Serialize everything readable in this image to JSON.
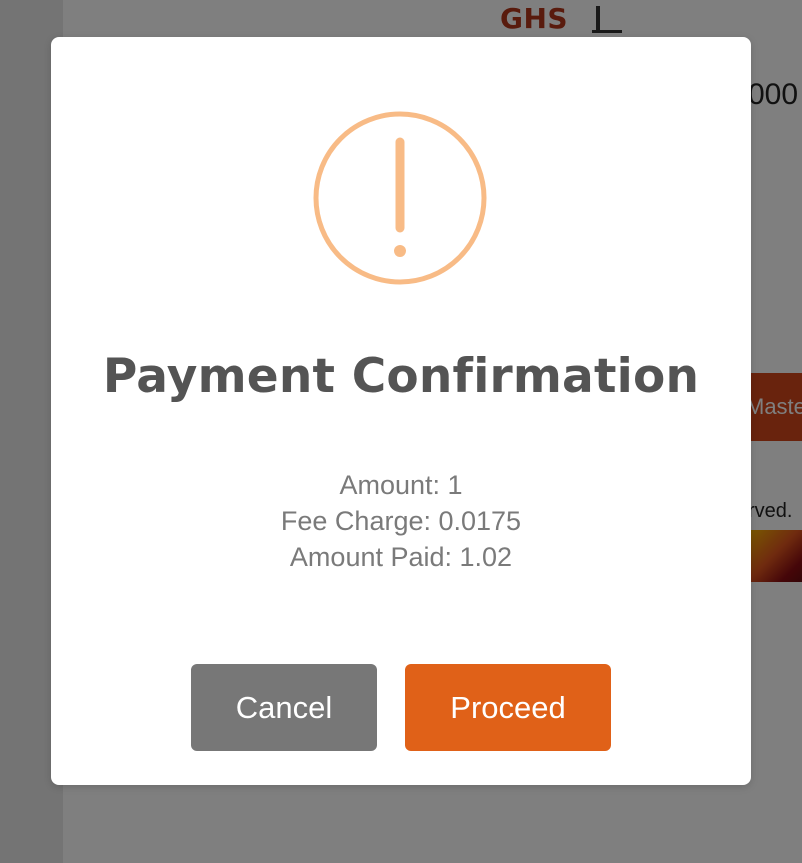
{
  "background": {
    "currency_label": "GHS",
    "amount_partial": "000",
    "pay_button_partial": "Maste",
    "footer_partial": "rved."
  },
  "dialog": {
    "icon": "exclamation-circle-icon",
    "icon_color": "#f8bb86",
    "title": "Payment Confirmation",
    "details": {
      "amount": "Amount: 1",
      "fee": "Fee Charge: 0.0175",
      "paid": "Amount Paid: 1.02"
    },
    "buttons": {
      "cancel_label": "Cancel",
      "proceed_label": "Proceed"
    },
    "colors": {
      "cancel": "#777777",
      "proceed": "#e06118"
    }
  }
}
